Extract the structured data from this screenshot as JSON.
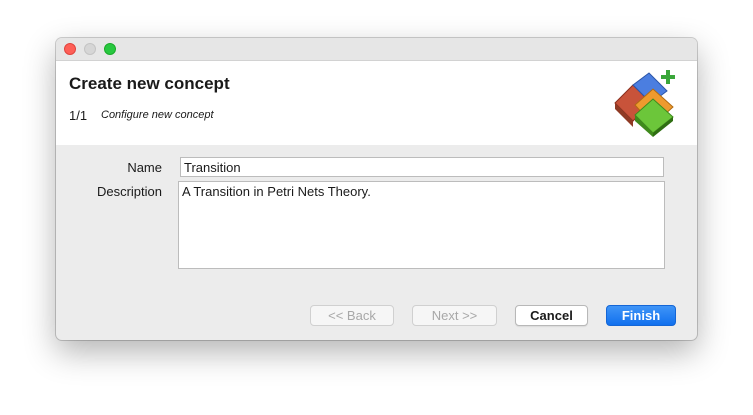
{
  "window": {
    "title": ""
  },
  "header": {
    "title": "Create new concept",
    "step_number": "1/1",
    "step_label": "Configure new concept",
    "logo_icon": "concept-puzzle-add-icon"
  },
  "form": {
    "name_label": "Name",
    "name_value": "Transition",
    "description_label": "Description",
    "description_value": "A Transition in Petri Nets Theory."
  },
  "buttons": {
    "back_label": "<< Back",
    "next_label": "Next >>",
    "cancel_label": "Cancel",
    "finish_label": "Finish"
  },
  "colors": {
    "accent": "#1a73ef",
    "window_bg": "#ececec",
    "header_bg": "#ffffff"
  }
}
